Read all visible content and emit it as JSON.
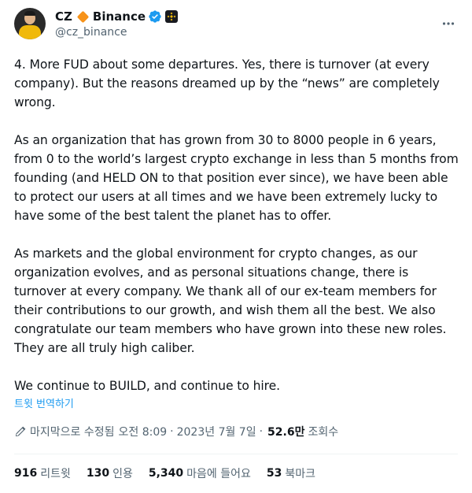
{
  "author": {
    "display_name": "CZ",
    "display_name_suffix": "Binance",
    "handle": "@cz_binance"
  },
  "icons": {
    "avatar": "profile-photo",
    "diamond": "orange-diamond-emoji",
    "verified": "verified-badge-icon",
    "org": "binance-logo-icon",
    "more": "more-options-icon",
    "edit": "edited-pen-icon"
  },
  "colors": {
    "accent": "#1d9bf0",
    "diamond": "#f7931a",
    "binance": "#f0b90b"
  },
  "tweet": {
    "text": "4. More FUD about some departures. Yes, there is turnover (at every company). But the reasons dreamed up by the “news” are completely wrong.\n\nAs an organization that has grown from 30 to 8000 people in 6 years, from 0 to the world’s largest crypto exchange in less than 5 months from founding (and HELD ON to that position ever since), we have been able to protect our users at all times and we have been extremely lucky to have some of the best talent the planet has to offer.\n\nAs markets and the global environment for crypto changes, as our organization evolves, and as personal situations change, there is turnover at every company. We thank all of our ex-team members for their contributions to our growth, and wish them all the best. We also congratulate our team members who have grown into these new roles. They are all truly high caliber.\n\nWe continue to BUILD, and continue to hire.",
    "translate_label": "트윗 번역하기"
  },
  "meta": {
    "edited_label": "마지막으로 수정됨",
    "time": "오전 8:09",
    "separator": "·",
    "date": "2023년 7월 7일",
    "views_count": "52.6만",
    "views_label": "조회수"
  },
  "stats": [
    {
      "count": "916",
      "label": "리트윗"
    },
    {
      "count": "130",
      "label": "인용"
    },
    {
      "count": "5,340",
      "label": "마음에 들어요"
    },
    {
      "count": "53",
      "label": "북마크"
    }
  ]
}
